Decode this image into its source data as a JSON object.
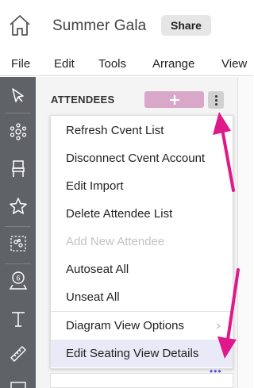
{
  "header": {
    "doc_title": "Summer Gala",
    "share_label": "Share"
  },
  "menubar": {
    "items": [
      "File",
      "Edit",
      "Tools",
      "Arrange",
      "View"
    ]
  },
  "toolbar": {
    "tools": [
      "select-pointer-icon",
      "dots-cluster-icon",
      "chair-icon",
      "star-icon",
      "dashed-selection-icon",
      "seat-number-pin-icon",
      "text-icon",
      "ruler-icon"
    ]
  },
  "panel": {
    "section_title": "ATTENDEES",
    "add_label": "+",
    "dropdown": {
      "items": [
        {
          "label": "Refresh Cvent List",
          "state": "enabled"
        },
        {
          "label": "Disconnect Cvent Account",
          "state": "enabled"
        },
        {
          "label": "Edit Import",
          "state": "enabled"
        },
        {
          "label": "Delete Attendee List",
          "state": "enabled"
        },
        {
          "label": "Add New Attendee",
          "state": "disabled"
        },
        {
          "label": "Autoseat All",
          "state": "enabled"
        },
        {
          "label": "Unseat All",
          "state": "enabled"
        },
        {
          "label": "Diagram View Options",
          "state": "submenu"
        },
        {
          "label": "Edit Seating View Details",
          "state": "highlighted"
        }
      ],
      "overflow_dots": "•••"
    }
  },
  "colors": {
    "toolbar_bg": "#5f6368",
    "add_button": "#d9a8c9",
    "annotation_arrow": "#e0198a",
    "highlight_row": "#e9e9f7"
  }
}
